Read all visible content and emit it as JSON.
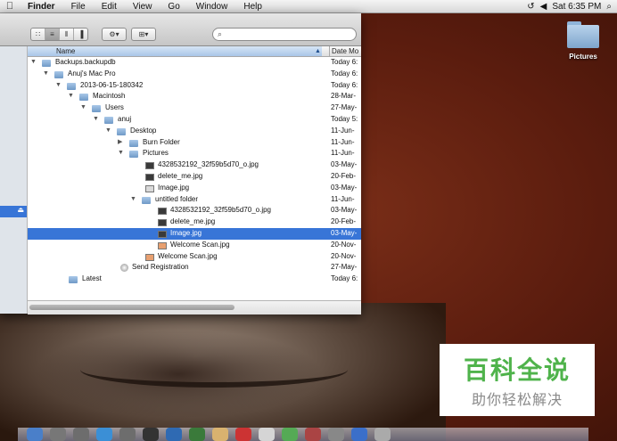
{
  "menubar": {
    "apple_icon": "apple-icon",
    "items": [
      "Finder",
      "File",
      "Edit",
      "View",
      "Go",
      "Window",
      "Help"
    ],
    "clock": "Sat 6:35 PM"
  },
  "desktop": {
    "folder_label": "Pictures"
  },
  "finder": {
    "columns": {
      "name": "Name",
      "date": "Date Mo"
    },
    "rows": [
      {
        "name": "Backups.backupdb",
        "date": "Today 6:"
      },
      {
        "name": "Anuj's Mac Pro",
        "date": "Today 6:"
      },
      {
        "name": "2013-06-15-180342",
        "date": "Today 6:"
      },
      {
        "name": "Macintosh",
        "date": "28-Mar-"
      },
      {
        "name": "Users",
        "date": "27-May-"
      },
      {
        "name": "anuj",
        "date": "Today 5:"
      },
      {
        "name": "Desktop",
        "date": "11-Jun-"
      },
      {
        "name": "Burn Folder",
        "date": "11-Jun-"
      },
      {
        "name": "Pictures",
        "date": "11-Jun-"
      },
      {
        "name": "4328532192_32f59b5d70_o.jpg",
        "date": "03-May-"
      },
      {
        "name": "delete_me.jpg",
        "date": "20-Feb-"
      },
      {
        "name": "Image.jpg",
        "date": "03-May-"
      },
      {
        "name": "untitled folder",
        "date": "11-Jun-"
      },
      {
        "name": "4328532192_32f59b5d70_o.jpg",
        "date": "03-May-"
      },
      {
        "name": "delete_me.jpg",
        "date": "20-Feb-"
      },
      {
        "name": "Image.jpg",
        "date": "03-May-"
      },
      {
        "name": "Welcome Scan.jpg",
        "date": "20-Nov-"
      },
      {
        "name": "Welcome Scan.jpg",
        "date": "20-Nov-"
      },
      {
        "name": "Send Registration",
        "date": "27-May-"
      },
      {
        "name": "Latest",
        "date": "Today 6:"
      }
    ]
  },
  "watermark": {
    "line1": "百科全说",
    "line2": "助你轻松解决"
  }
}
